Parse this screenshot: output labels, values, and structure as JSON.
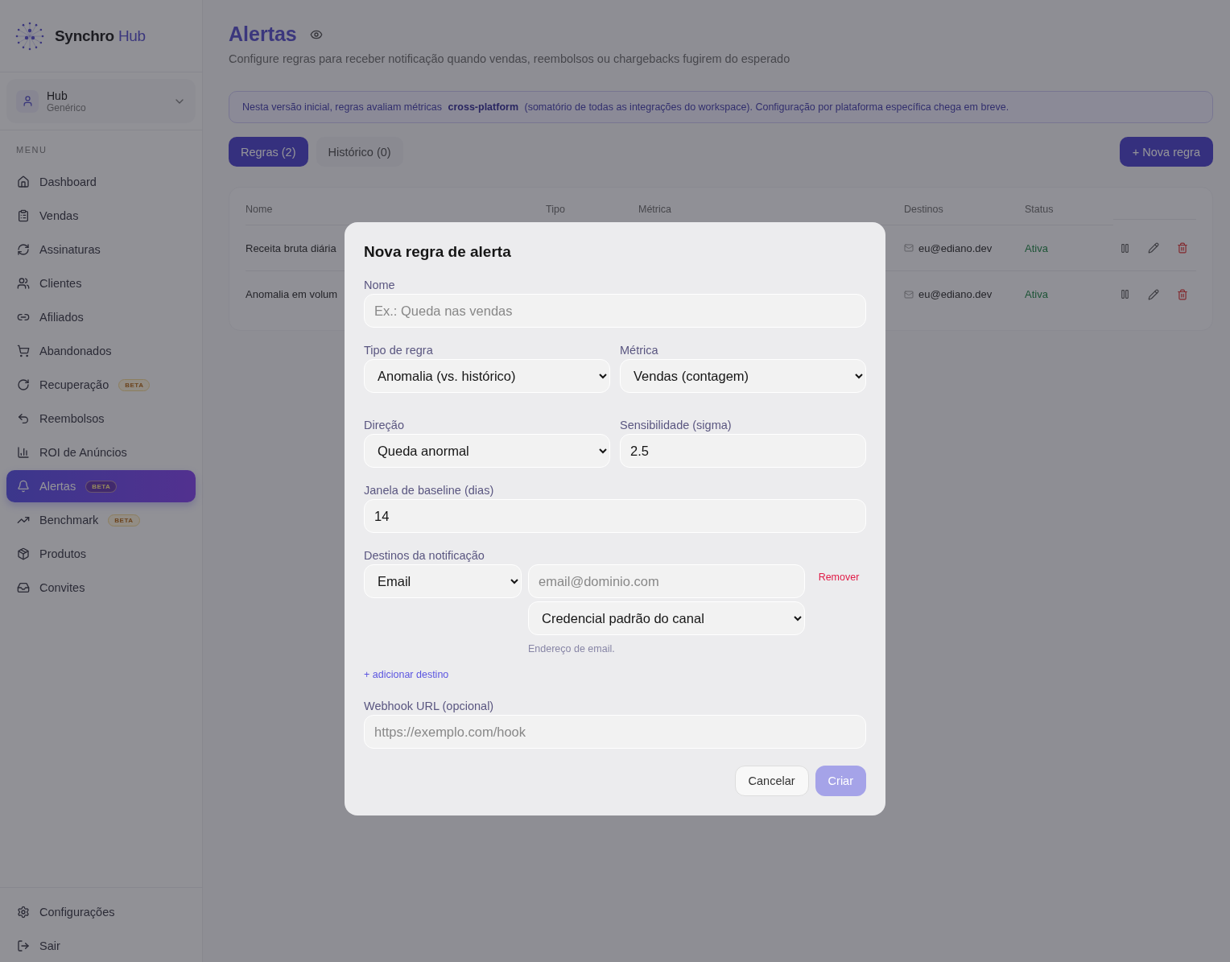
{
  "brand": {
    "name": "Synchro",
    "accent": "Hub"
  },
  "workspace": {
    "name": "Hub",
    "subtitle": "Genérico"
  },
  "menu": {
    "label": "MENU",
    "items": [
      {
        "label": "Dashboard",
        "selected": false
      },
      {
        "label": "Vendas",
        "selected": false
      },
      {
        "label": "Assinaturas",
        "selected": false
      },
      {
        "label": "Clientes",
        "selected": false
      },
      {
        "label": "Afiliados",
        "selected": false
      },
      {
        "label": "Abandonados",
        "selected": false
      },
      {
        "label": "Recuperação",
        "badge": "BETA",
        "selected": false
      },
      {
        "label": "Reembolsos",
        "selected": false
      },
      {
        "label": "ROI de Anúncios",
        "selected": false
      },
      {
        "label": "Alertas",
        "badge": "BETA",
        "selected": true
      },
      {
        "label": "Benchmark",
        "badge": "BETA",
        "selected": false
      },
      {
        "label": "Produtos",
        "selected": false
      },
      {
        "label": "Convites",
        "selected": false
      }
    ]
  },
  "footer_items": [
    {
      "label": "Configurações"
    },
    {
      "label": "Sair"
    }
  ],
  "page": {
    "title": "Alertas",
    "subtitle": "Configure regras para receber notificação quando vendas, reembolsos ou chargebacks fugirem do esperado",
    "notice": "Nesta versão inicial, regras avaliam métricas **cross-platform** (somatório de todas as integrações do workspace). Configuração por plataforma específica chega em breve."
  },
  "tabs": [
    {
      "label": "Regras (2)",
      "selected": true
    },
    {
      "label": "Histórico (0)",
      "selected": false
    }
  ],
  "new_rule_button": "+ Nova regra",
  "table": {
    "columns": [
      "Nome",
      "Tipo",
      "Métrica",
      "Destinos",
      "Status"
    ],
    "rows": [
      {
        "name": "Receita bruta diária",
        "destination": "eu@ediano.dev",
        "status": "Ativa"
      },
      {
        "name": "Anomalia em volum",
        "destination": "eu@ediano.dev",
        "status": "Ativa"
      }
    ]
  },
  "modal": {
    "title": "Nova regra de alerta",
    "name_field": {
      "label": "Nome",
      "placeholder": "Ex.: Queda nas vendas"
    },
    "rule_type": {
      "label": "Tipo de regra",
      "value": "Anomalia (vs. histórico)"
    },
    "metric": {
      "label": "Métrica",
      "value": "Vendas (contagem)"
    },
    "direction": {
      "label": "Direção",
      "value": "Queda anormal"
    },
    "sensitivity": {
      "label": "Sensibilidade (sigma)",
      "value": "2.5"
    },
    "baseline": {
      "label": "Janela de baseline (dias)",
      "value": "14"
    },
    "destinations": {
      "label": "Destinos da notificação",
      "items": [
        {
          "channel": "Email",
          "address_placeholder": "email@dominio.com",
          "credential": "Credencial padrão do canal",
          "hint": "Endereço de email.",
          "remove": "Remover"
        }
      ],
      "add_link": "+ adicionar destino"
    },
    "webhook": {
      "label": "Webhook URL (opcional)",
      "placeholder": "https://exemplo.com/hook"
    },
    "cancel": "Cancelar",
    "submit": {
      "label": "Criar",
      "disabled": true
    }
  }
}
